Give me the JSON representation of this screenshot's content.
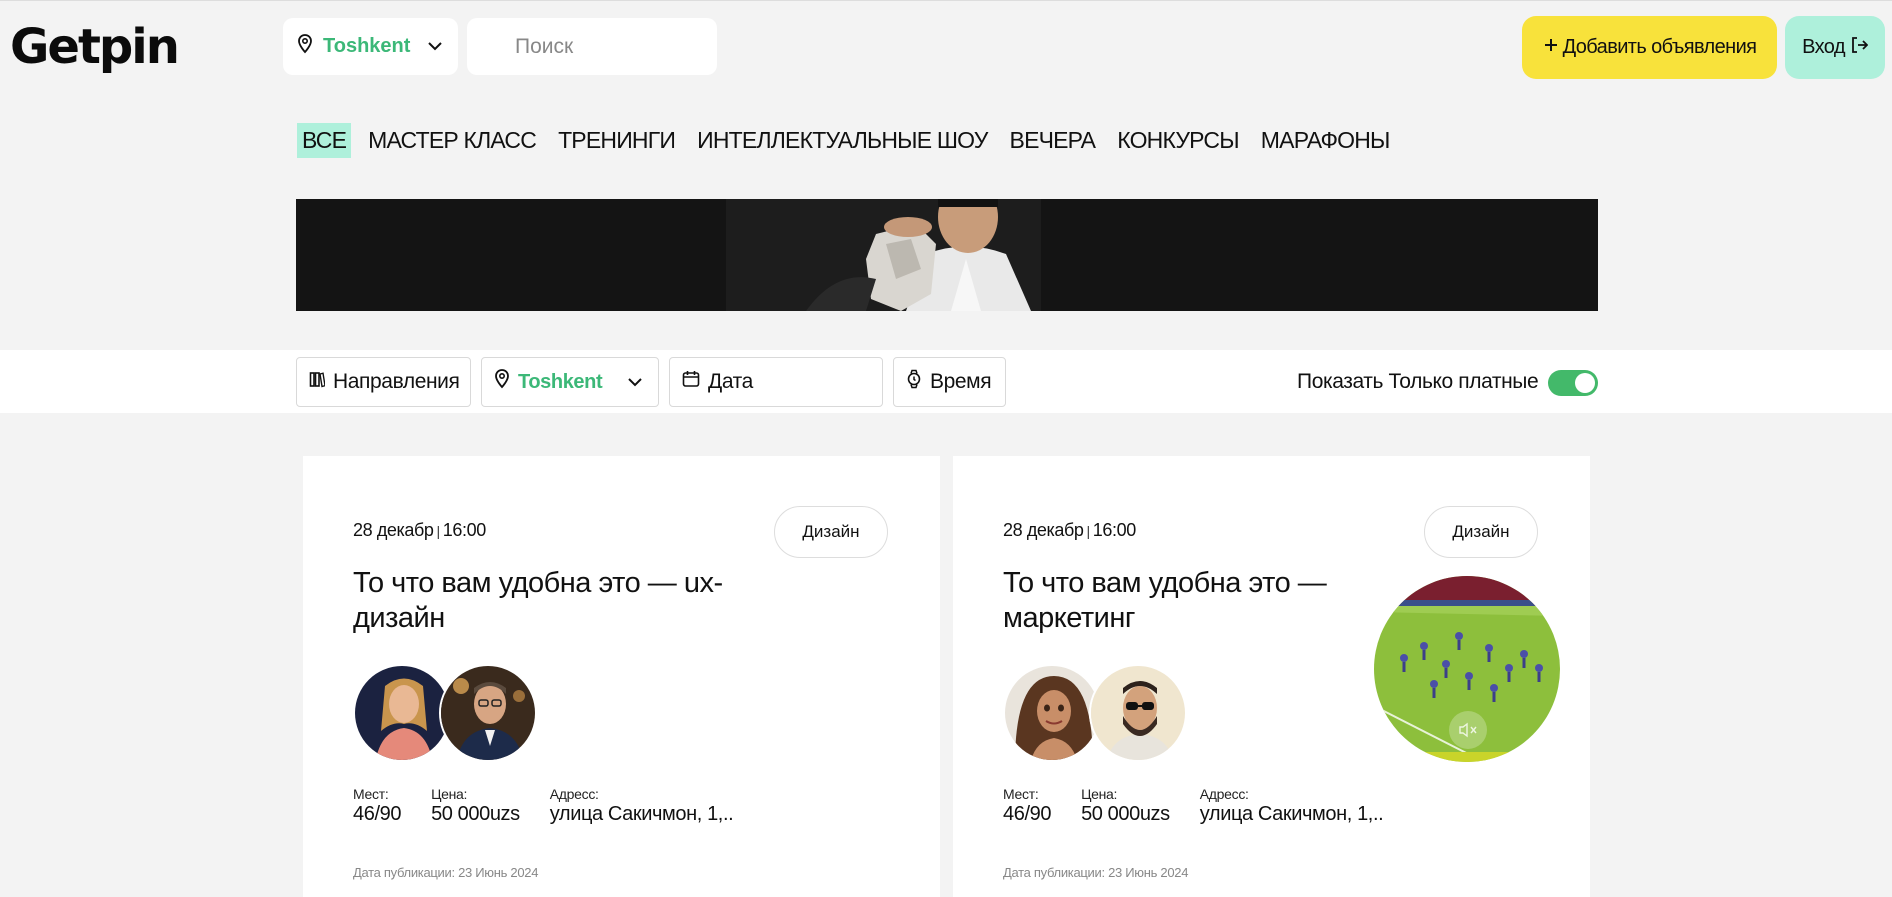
{
  "header": {
    "logo": "Getpin",
    "city": "Toshkent",
    "search_placeholder": "Поиск",
    "add_label": "Добавить объявления",
    "login_label": "Вход"
  },
  "categories": [
    {
      "label": "ВСЕ",
      "active": true
    },
    {
      "label": "МАСТЕР КЛАСС"
    },
    {
      "label": "ТРЕНИНГИ"
    },
    {
      "label": "ИНТЕЛЛЕКТУАЛЬНЫЕ ШОУ"
    },
    {
      "label": "ВЕЧЕРА"
    },
    {
      "label": "КОНКУРСЫ"
    },
    {
      "label": "МАРАФОНЫ"
    }
  ],
  "filters": {
    "directions": "Направления",
    "city": "Toshkent",
    "date": "Дата",
    "time": "Время",
    "paid_only_label": "Показать Только платные",
    "paid_only": true
  },
  "cards": [
    {
      "date": "28 декабр",
      "time": "16:00",
      "tag": "Дизайн",
      "title": "То что вам удобна это — ux-дизайн",
      "seats_label": "Мест:",
      "seats": "46/90",
      "price_label": "Цена:",
      "price": "50 000uzs",
      "address_label": "Адресс:",
      "address": "улица Сакичмон, 1,..",
      "published": "Дата публикации: 23 Июнь 2024"
    },
    {
      "date": "28 декабр",
      "time": "16:00",
      "tag": "Дизайн",
      "title": "То что вам удобна это — маркетинг",
      "seats_label": "Мест:",
      "seats": "46/90",
      "price_label": "Цена:",
      "price": "50 000uzs",
      "address_label": "Адресс:",
      "address": "улица Сакичмон, 1,..",
      "published": "Дата публикации: 23 Июнь 2024"
    }
  ],
  "colors": {
    "accent_green": "#3cb878",
    "mint": "#aef0db",
    "yellow": "#f8e23b",
    "toggle_green": "#43b96a"
  }
}
